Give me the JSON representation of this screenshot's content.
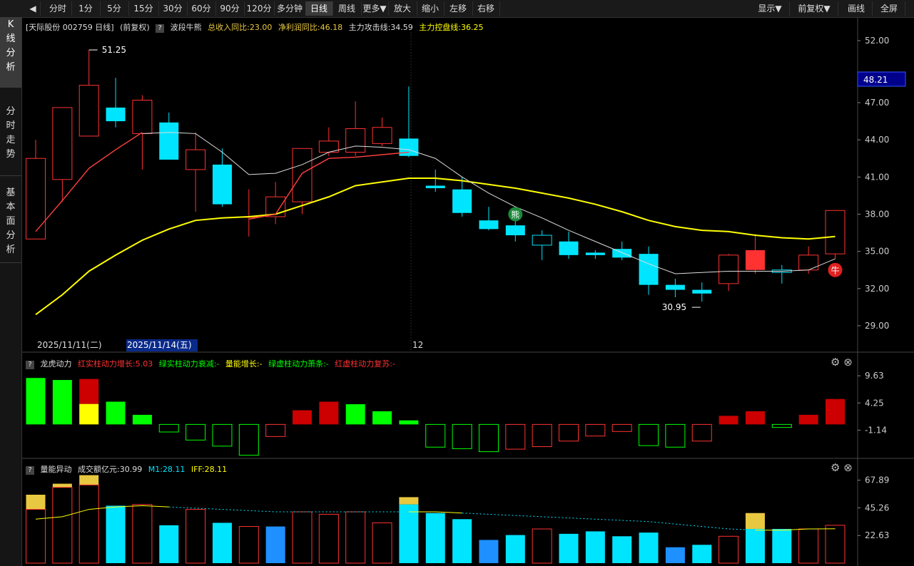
{
  "toolbar": {
    "back_icon": "back-icon",
    "periods": [
      "分时",
      "1分",
      "5分",
      "15分",
      "30分",
      "60分",
      "90分",
      "120分",
      "多分钟",
      "日线",
      "周线",
      "更多▼",
      "放大",
      "缩小",
      "左移",
      "右移"
    ],
    "active_period": "日线",
    "right_items": [
      "显示▼",
      "前复权▼",
      "画线",
      "全屏"
    ]
  },
  "sidebar": {
    "tabs": [
      {
        "label": "K线分析",
        "active": true
      },
      {
        "label": "分时走势",
        "active": false
      },
      {
        "label": "基本面分析",
        "active": false
      }
    ]
  },
  "main_info": {
    "stock": "[天际股份 002759 日线]",
    "adjust": "(前复权)",
    "indicator": "波段牛熊",
    "revenue": "总收入同比:23.00",
    "profit": "净利润同比:46.18",
    "attack": "主力攻击线:34.59",
    "control": "主力控盘线:36.25"
  },
  "sub1_info": {
    "name": "龙虎动力",
    "red_solid": "红实柱动力增长:5.03",
    "green_solid": "绿实柱动力衰减:-",
    "volume_grow": "量能增长:-",
    "green_hollow": "绿虚柱动力萧条:-",
    "red_hollow": "红虚柱动力复苏:-"
  },
  "sub2_info": {
    "name": "量能异动",
    "amount": "成交额亿元:30.99",
    "m1": "M1:28.11",
    "iff": "IFF:28.11"
  },
  "colors": {
    "up": "#ff3232",
    "down": "#00e5ff",
    "ma_yellow": "#ffff00",
    "ma_white": "#dddddd",
    "ma_red": "#ff4040",
    "green": "#00ff00",
    "gold": "#e8c840",
    "blue": "#1e90ff",
    "red_bar": "#cc0000"
  },
  "chart_data": {
    "type": "candlestick",
    "price_axis": {
      "min": 29.0,
      "max": 52.0,
      "ticks": [
        "52.00",
        "47.00",
        "44.00",
        "41.00",
        "38.00",
        "35.00",
        "32.00",
        "29.00"
      ],
      "current": "48.21"
    },
    "date_labels": [
      "2025/11/11(二)",
      "2025/11/14(五)",
      "12"
    ],
    "annotations": {
      "high": "51.25",
      "low": "30.95",
      "bear_mark": "熊",
      "bull_mark": "牛"
    },
    "candles": [
      {
        "o": 36.0,
        "c": 42.5,
        "h": 44.0,
        "l": 36.0
      },
      {
        "o": 40.8,
        "c": 46.6,
        "h": 46.6,
        "l": 39.0
      },
      {
        "o": 44.3,
        "c": 48.4,
        "h": 51.25,
        "l": 44.3
      },
      {
        "o": 46.6,
        "c": 45.5,
        "h": 49.0,
        "l": 45.0
      },
      {
        "o": 44.5,
        "c": 47.2,
        "h": 47.6,
        "l": 41.6
      },
      {
        "o": 45.4,
        "c": 42.4,
        "h": 46.2,
        "l": 42.4
      },
      {
        "o": 41.6,
        "c": 43.2,
        "h": 44.6,
        "l": 38.2
      },
      {
        "o": 42.0,
        "c": 38.8,
        "h": 43.3,
        "l": 38.6
      },
      {
        "o": 37.8,
        "c": 37.8,
        "h": 40.0,
        "l": 36.2
      },
      {
        "o": 37.8,
        "c": 39.4,
        "h": 40.6,
        "l": 37.2
      },
      {
        "o": 39.0,
        "c": 43.3,
        "h": 43.3,
        "l": 38.0
      },
      {
        "o": 43.0,
        "c": 43.9,
        "h": 45.0,
        "l": 42.7
      },
      {
        "o": 43.0,
        "c": 44.9,
        "h": 47.1,
        "l": 42.7
      },
      {
        "o": 43.7,
        "c": 45.0,
        "h": 45.8,
        "l": 43.5
      },
      {
        "o": 44.1,
        "c": 42.7,
        "h": 48.3,
        "l": 42.6
      },
      {
        "o": 40.3,
        "c": 40.1,
        "h": 41.6,
        "l": 39.8
      },
      {
        "o": 40.0,
        "c": 38.1,
        "h": 41.0,
        "l": 37.8
      },
      {
        "o": 37.5,
        "c": 36.8,
        "h": 38.6,
        "l": 36.7
      },
      {
        "o": 37.1,
        "c": 36.3,
        "h": 37.5,
        "l": 35.8
      },
      {
        "o": 36.3,
        "c": 35.5,
        "h": 36.7,
        "l": 34.3
      },
      {
        "o": 35.8,
        "c": 34.7,
        "h": 36.6,
        "l": 34.4
      },
      {
        "o": 34.9,
        "c": 34.7,
        "h": 35.1,
        "l": 34.4
      },
      {
        "o": 35.2,
        "c": 34.5,
        "h": 35.8,
        "l": 34.3
      },
      {
        "o": 34.8,
        "c": 32.3,
        "h": 35.4,
        "l": 31.5
      },
      {
        "o": 32.3,
        "c": 31.9,
        "h": 32.8,
        "l": 31.3
      },
      {
        "o": 31.9,
        "c": 31.6,
        "h": 32.5,
        "l": 30.95
      },
      {
        "o": 32.4,
        "c": 34.7,
        "h": 34.8,
        "l": 31.8
      },
      {
        "o": 33.5,
        "c": 35.1,
        "h": 36.4,
        "l": 33.2
      },
      {
        "o": 33.5,
        "c": 33.3,
        "h": 33.9,
        "l": 32.4
      },
      {
        "o": 33.5,
        "c": 34.7,
        "h": 35.4,
        "l": 33.2
      },
      {
        "o": 34.8,
        "c": 38.3,
        "h": 38.3,
        "l": 34.4
      }
    ],
    "ma_yellow": [
      29.9,
      31.5,
      33.4,
      34.7,
      35.9,
      36.8,
      37.5,
      37.7,
      37.8,
      38.0,
      38.7,
      39.4,
      40.3,
      40.6,
      40.9,
      40.9,
      40.7,
      40.4,
      40.1,
      39.7,
      39.3,
      38.8,
      38.2,
      37.5,
      37.0,
      36.7,
      36.6,
      36.3,
      36.1,
      36.0,
      36.2
    ],
    "ma_white": [
      null,
      null,
      null,
      null,
      44.5,
      44.6,
      44.5,
      43.0,
      41.2,
      41.3,
      42.0,
      43.0,
      43.5,
      43.4,
      43.2,
      42.5,
      41.0,
      39.7,
      38.6,
      37.7,
      36.7,
      35.8,
      34.9,
      34.0,
      33.2,
      33.3,
      33.4,
      33.4,
      33.4,
      33.5,
      34.4
    ],
    "ma_red": [
      36.6,
      39.1,
      41.7,
      43.2,
      44.6,
      null,
      null,
      null,
      37.6,
      38.0,
      41.3,
      42.5,
      42.6,
      42.8,
      43.0,
      null,
      null,
      null,
      null,
      null,
      null,
      null,
      null,
      null,
      null,
      null,
      null,
      null,
      null,
      null,
      null
    ],
    "power_axis": {
      "ticks": [
        "9.63",
        "4.25",
        "-1.14"
      ]
    },
    "power_bars": [
      {
        "v": 9.2,
        "t": "green"
      },
      {
        "v": 8.8,
        "t": "green"
      },
      {
        "v": 9.0,
        "t": "redyellow"
      },
      {
        "v": 4.5,
        "t": "green"
      },
      {
        "v": 1.9,
        "t": "green"
      },
      {
        "v": -1.5,
        "t": "greenh"
      },
      {
        "v": -3.1,
        "t": "greenh"
      },
      {
        "v": -4.3,
        "t": "greenh"
      },
      {
        "v": -6.1,
        "t": "greenh"
      },
      {
        "v": -2.4,
        "t": "redh"
      },
      {
        "v": 2.8,
        "t": "red"
      },
      {
        "v": 4.5,
        "t": "red"
      },
      {
        "v": 4.0,
        "t": "green"
      },
      {
        "v": 2.6,
        "t": "green"
      },
      {
        "v": 0.8,
        "t": "green"
      },
      {
        "v": -4.5,
        "t": "greenh"
      },
      {
        "v": -4.8,
        "t": "greenh"
      },
      {
        "v": -5.4,
        "t": "greenh"
      },
      {
        "v": -4.9,
        "t": "redh"
      },
      {
        "v": -4.4,
        "t": "redh"
      },
      {
        "v": -3.3,
        "t": "redh"
      },
      {
        "v": -2.3,
        "t": "redh"
      },
      {
        "v": -1.4,
        "t": "redh"
      },
      {
        "v": -4.2,
        "t": "greenh"
      },
      {
        "v": -4.5,
        "t": "greenh"
      },
      {
        "v": -3.3,
        "t": "redh"
      },
      {
        "v": 1.7,
        "t": "red"
      },
      {
        "v": 2.6,
        "t": "red"
      },
      {
        "v": -0.6,
        "t": "greenh"
      },
      {
        "v": 1.9,
        "t": "red"
      },
      {
        "v": 5.03,
        "t": "red"
      }
    ],
    "vol_axis": {
      "ticks": [
        "67.89",
        "45.26",
        "22.63"
      ]
    },
    "vol_bars": [
      {
        "v": 44,
        "t": "redh",
        "g": 12
      },
      {
        "v": 62,
        "t": "redh",
        "g": 3
      },
      {
        "v": 64,
        "t": "redh",
        "g": 8
      },
      {
        "v": 47,
        "t": "cyan",
        "g": 0
      },
      {
        "v": 48,
        "t": "redh",
        "g": 0
      },
      {
        "v": 31,
        "t": "cyan",
        "g": 0
      },
      {
        "v": 44,
        "t": "redh",
        "g": 0
      },
      {
        "v": 33,
        "t": "cyan",
        "g": 0
      },
      {
        "v": 30,
        "t": "redh",
        "g": 0
      },
      {
        "v": 30,
        "t": "blue",
        "g": 0
      },
      {
        "v": 42,
        "t": "redh",
        "g": 0
      },
      {
        "v": 40,
        "t": "redh",
        "g": 0
      },
      {
        "v": 42,
        "t": "redh",
        "g": 0
      },
      {
        "v": 33,
        "t": "redh",
        "g": 0
      },
      {
        "v": 48,
        "t": "cyan",
        "g": 6
      },
      {
        "v": 41,
        "t": "cyan",
        "g": 0
      },
      {
        "v": 36,
        "t": "cyan",
        "g": 0
      },
      {
        "v": 19,
        "t": "blue",
        "g": 0
      },
      {
        "v": 23,
        "t": "cyan",
        "g": 0
      },
      {
        "v": 28,
        "t": "redh",
        "g": 0
      },
      {
        "v": 24,
        "t": "cyan",
        "g": 0
      },
      {
        "v": 26,
        "t": "cyan",
        "g": 0
      },
      {
        "v": 22,
        "t": "cyan",
        "g": 0
      },
      {
        "v": 25,
        "t": "cyan",
        "g": 0
      },
      {
        "v": 13,
        "t": "blue",
        "g": 0
      },
      {
        "v": 15,
        "t": "cyan",
        "g": 0
      },
      {
        "v": 22,
        "t": "redh",
        "g": 0
      },
      {
        "v": 28,
        "t": "cyan",
        "g": 13
      },
      {
        "v": 28,
        "t": "cyan",
        "g": 0
      },
      {
        "v": 28,
        "t": "redh",
        "g": 0
      },
      {
        "v": 30.99,
        "t": "redh",
        "g": 0
      }
    ],
    "vol_ma": [
      36,
      38,
      44,
      46,
      47,
      46,
      45,
      44,
      43,
      42,
      42,
      42,
      42,
      42,
      42,
      42,
      41,
      40,
      39,
      38,
      37,
      36,
      35,
      34,
      32,
      30,
      28,
      27,
      27,
      28,
      28.11
    ]
  }
}
